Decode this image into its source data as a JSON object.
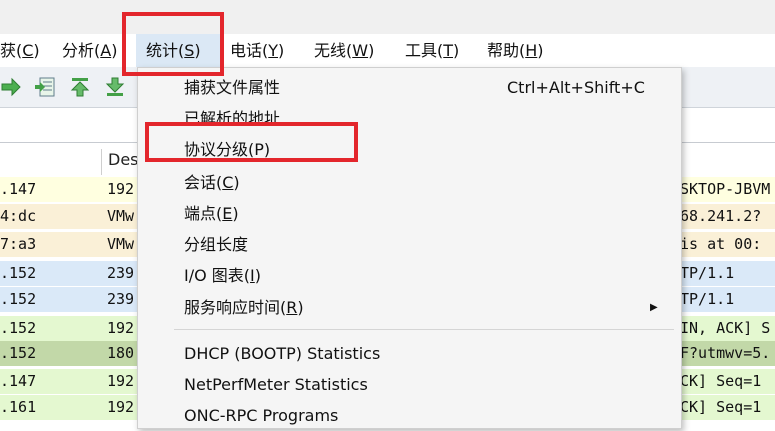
{
  "menubar": {
    "items": [
      {
        "label": "获(",
        "key": "C",
        "end": ")"
      },
      {
        "label": "分析(",
        "key": "A",
        "end": ")"
      },
      {
        "label": "统计(",
        "key": "S",
        "end": ")"
      },
      {
        "label": "电话(",
        "key": "Y",
        "end": ")"
      },
      {
        "label": "无线(",
        "key": "W",
        "end": ")"
      },
      {
        "label": "工具(",
        "key": "T",
        "end": ")"
      },
      {
        "label": "帮助(",
        "key": "H",
        "end": ")"
      }
    ]
  },
  "columns": {
    "destination_partial": "Des"
  },
  "rows": [
    {
      "c0": ".147",
      "c1": "192",
      "c2": "SKTOP-JBVM",
      "color": "#ffffe0"
    },
    {
      "c0": "4:dc",
      "c1": "VMw",
      "c2": "68.241.2?",
      "color": "#faf0d7"
    },
    {
      "c0": "7:a3",
      "c1": "VMw",
      "c2": " is at 00:",
      "color": "#faf0d7"
    },
    {
      "c0": ".152",
      "c1": "239",
      "c2": "TP/1.1",
      "color": "#dae9f8"
    },
    {
      "c0": ".152",
      "c1": "239",
      "c2": "TP/1.1",
      "color": "#dae9f8"
    },
    {
      "c0": ".152",
      "c1": "192",
      "c2": "IN, ACK] S",
      "color": "#e4f8d0"
    },
    {
      "c0": ".152",
      "c1": "180",
      "c2": "F?utmwv=5.",
      "color": "#c2d8a8"
    },
    {
      "c0": ".147",
      "c1": "192",
      "c2": "CK] Seq=1",
      "color": "#e4f8d0"
    },
    {
      "c0": ".161",
      "c1": "192",
      "c2": "CK] Seq=1",
      "color": "#e4f8d0"
    }
  ],
  "dropdown": {
    "items": [
      {
        "pre": "捕获文件属性",
        "key": "",
        "post": "",
        "shortcut": "Ctrl+Alt+Shift+C"
      },
      {
        "pre": "已解析的地址",
        "key": "",
        "post": "",
        "shortcut": ""
      },
      {
        "pre": "协议分级(P)",
        "key": "",
        "post": "",
        "shortcut": ""
      },
      {
        "pre": "会话(",
        "key": "C",
        "post": ")",
        "shortcut": ""
      },
      {
        "pre": "端点(",
        "key": "E",
        "post": ")",
        "shortcut": ""
      },
      {
        "pre": "分组长度",
        "key": "",
        "post": "",
        "shortcut": ""
      },
      {
        "pre": "I/O 图表(",
        "key": "I",
        "post": ")",
        "shortcut": ""
      },
      {
        "pre": "服务响应时间(",
        "key": "R",
        "post": ")",
        "shortcut": "",
        "submenu": "▶"
      },
      {
        "pre": "DHCP (BOOTP) Statistics",
        "key": "",
        "post": "",
        "shortcut": ""
      },
      {
        "pre": "NetPerfMeter Statistics",
        "key": "",
        "post": "",
        "shortcut": ""
      },
      {
        "pre": "ONC-RPC Programs",
        "key": "",
        "post": "",
        "shortcut": ""
      }
    ]
  },
  "colors": {
    "highlight_box": "#e3262c",
    "menu_active": "#dbe8f5"
  },
  "toolbar": {
    "icons": [
      "arrow-right-icon",
      "jump-to-packet-icon",
      "go-to-first-icon",
      "go-to-last-icon"
    ]
  }
}
